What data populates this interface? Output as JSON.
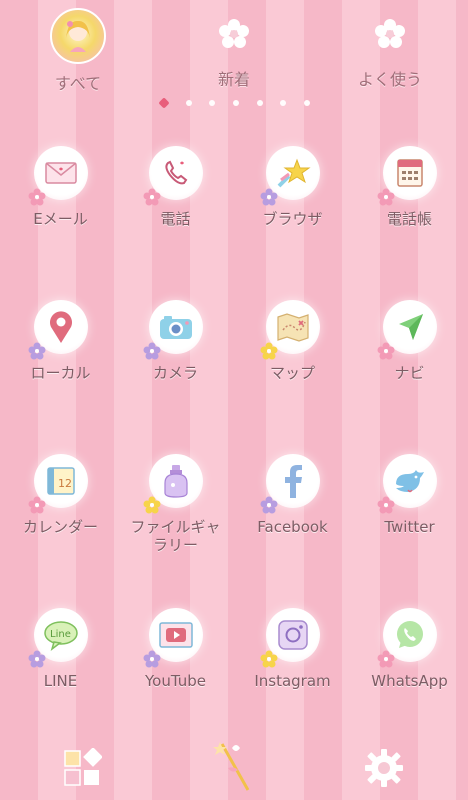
{
  "tabs": [
    {
      "label": "すべて",
      "icon": "avatar-girl-icon"
    },
    {
      "label": "新着",
      "icon": "flower-icon"
    },
    {
      "label": "よく使う",
      "icon": "flower-icon"
    }
  ],
  "pager": {
    "pages": 7,
    "active": 1
  },
  "apps": [
    {
      "label": "Eメール",
      "icon": "envelope-icon"
    },
    {
      "label": "電話",
      "icon": "phone-icon"
    },
    {
      "label": "ブラウザ",
      "icon": "shooting-star-icon"
    },
    {
      "label": "電話帳",
      "icon": "address-book-icon"
    },
    {
      "label": "ローカル",
      "icon": "map-pin-icon"
    },
    {
      "label": "カメラ",
      "icon": "camera-icon"
    },
    {
      "label": "マップ",
      "icon": "map-icon"
    },
    {
      "label": "ナビ",
      "icon": "navigation-arrow-icon"
    },
    {
      "label": "カレンダー",
      "icon": "calendar-icon"
    },
    {
      "label": "ファイルギャラリー",
      "label_line1": "ファイルギャ",
      "label_line2": "ラリー",
      "icon": "perfume-bottle-icon"
    },
    {
      "label": "Facebook",
      "icon": "facebook-icon"
    },
    {
      "label": "Twitter",
      "icon": "bird-icon"
    },
    {
      "label": "LINE",
      "icon": "line-chat-icon"
    },
    {
      "label": "YouTube",
      "icon": "youtube-icon"
    },
    {
      "label": "Instagram",
      "icon": "instagram-icon"
    },
    {
      "label": "WhatsApp",
      "icon": "whatsapp-icon"
    }
  ],
  "dock": [
    {
      "icon": "app-drawer-icon"
    },
    {
      "icon": "magic-wand-icon"
    },
    {
      "icon": "settings-gear-icon"
    }
  ],
  "colors": {
    "stripe_a": "#f6b8c8",
    "stripe_b": "#fac9d5",
    "label": "#7d5c64",
    "accent": "#e85e7b"
  }
}
